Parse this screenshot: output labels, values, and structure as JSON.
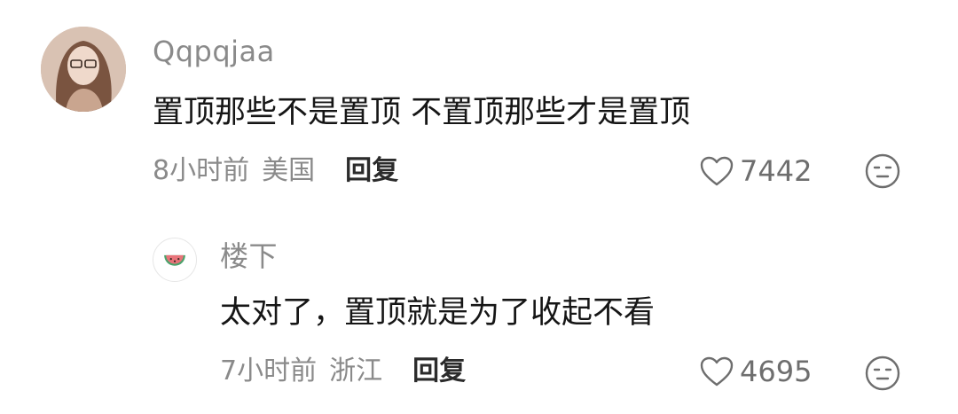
{
  "comments": [
    {
      "username": "Qqpqjaa",
      "text": "置顶那些不是置顶 不置顶那些才是置顶",
      "time": "8小时前",
      "location": "美国",
      "reply_label": "回复",
      "likes": "7442"
    },
    {
      "username": "楼下",
      "text": "太对了，置顶就是为了收起不看",
      "time": "7小时前",
      "location": "浙江",
      "reply_label": "回复",
      "likes": "4695"
    }
  ],
  "icons": {
    "like": "heart-outline-icon",
    "reaction": "neutral-face-icon",
    "reply_avatar": "watermelon-icon"
  },
  "colors": {
    "meta_text": "#8a8a8a",
    "body_text": "#161616",
    "watermelon_red": "#e8747a",
    "watermelon_green": "#4aa36c"
  }
}
